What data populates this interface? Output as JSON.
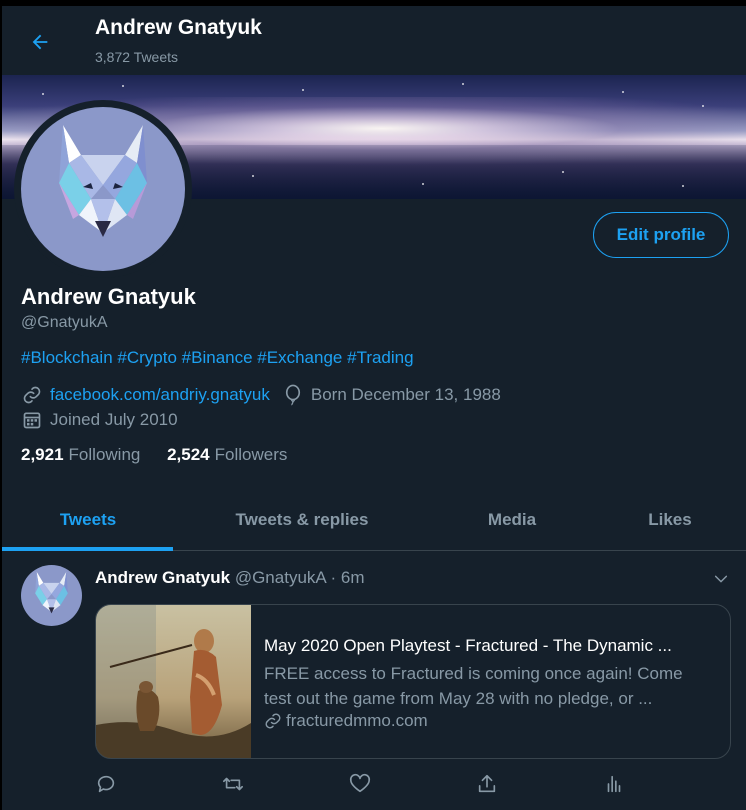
{
  "header": {
    "title": "Andrew Gnatyuk",
    "tweet_count": "3,872 Tweets"
  },
  "profile": {
    "name": "Andrew Gnatyuk",
    "handle": "@GnatyukA",
    "edit_label": "Edit profile",
    "bio_tags": [
      "#Blockchain",
      "#Crypto",
      "#Binance",
      "#Exchange",
      "#Trading"
    ],
    "website": "facebook.com/andriy.gnatyuk",
    "birthday": "Born December 13, 1988",
    "joined": "Joined July 2010",
    "following_count": "2,921",
    "following_label": "Following",
    "followers_count": "2,524",
    "followers_label": "Followers"
  },
  "tabs": [
    {
      "label": "Tweets",
      "active": true
    },
    {
      "label": "Tweets & replies",
      "active": false
    },
    {
      "label": "Media",
      "active": false
    },
    {
      "label": "Likes",
      "active": false
    }
  ],
  "tweet": {
    "author": "Andrew Gnatyuk",
    "meta": "@GnatyukA · 6m",
    "card": {
      "title": "May 2020 Open Playtest - Fractured - The Dynamic ...",
      "desc_line1": "FREE access to Fractured is coming once again! Come",
      "desc_line2": "test out the game from May 28 with no pledge, or ...",
      "domain": "fracturedmmo.com"
    },
    "actions": [
      "reply-icon",
      "retweet-icon",
      "like-icon",
      "share-icon",
      "analytics-icon"
    ]
  },
  "colors": {
    "background": "#15202b",
    "accent": "#1da1f2",
    "secondary_text": "#8899a6",
    "border": "#38444d"
  }
}
